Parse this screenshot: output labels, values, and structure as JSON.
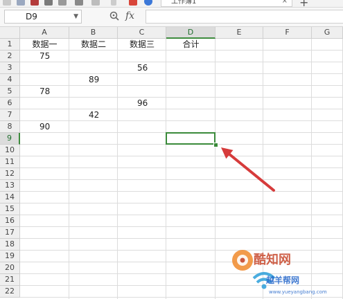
{
  "toolbar": {
    "document_tab_title": "工作簿1",
    "tab_close_glyph": "×",
    "new_tab_glyph": "+"
  },
  "formula_bar": {
    "name_box_value": "D9",
    "fx_label": "fx",
    "formula_value": ""
  },
  "sheet": {
    "columns": [
      "A",
      "B",
      "C",
      "D",
      "E",
      "F",
      "G"
    ],
    "rows": [
      "1",
      "2",
      "3",
      "4",
      "5",
      "6",
      "7",
      "8",
      "9",
      "10",
      "11",
      "12",
      "13",
      "14",
      "15",
      "16",
      "17",
      "18",
      "19",
      "20",
      "21",
      "22"
    ],
    "active_cell": "D9",
    "active_column": "D",
    "active_row": "9",
    "header_row": [
      "数据一",
      "数据二",
      "数据三",
      "合计"
    ],
    "values": [
      {
        "cell": "A2",
        "value": "75"
      },
      {
        "cell": "C3",
        "value": "56"
      },
      {
        "cell": "B4",
        "value": "89"
      },
      {
        "cell": "A5",
        "value": "78"
      },
      {
        "cell": "C6",
        "value": "96"
      },
      {
        "cell": "B7",
        "value": "42"
      },
      {
        "cell": "A8",
        "value": "90"
      }
    ]
  },
  "watermark": {
    "brand_text": "酷知网",
    "sub_text": "越羊帮网",
    "url_text": "www.yueyangbang.com"
  },
  "colors": {
    "selection_green": "#3a8a3a",
    "arrow_red": "#d63b3b"
  }
}
